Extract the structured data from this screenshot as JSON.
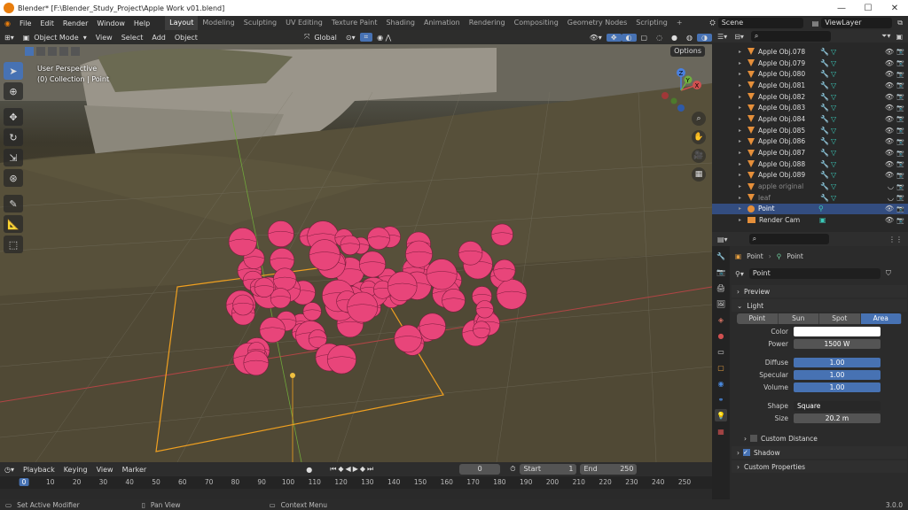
{
  "window": {
    "title": "Blender* [F:\\Blender_Study_Project\\Apple Work v01.blend]",
    "buttons": [
      "—",
      "☐",
      "✕"
    ]
  },
  "menu": [
    "File",
    "Edit",
    "Render",
    "Window",
    "Help"
  ],
  "workspaces": [
    "Layout",
    "Modeling",
    "Sculpting",
    "UV Editing",
    "Texture Paint",
    "Shading",
    "Animation",
    "Rendering",
    "Compositing",
    "Geometry Nodes",
    "Scripting"
  ],
  "active_workspace": "Layout",
  "add_workspace": "+",
  "scene": "Scene",
  "view_layer": "ViewLayer",
  "viewport": {
    "mode": "Object Mode",
    "menus": [
      "View",
      "Select",
      "Add",
      "Object"
    ],
    "transform": "Global",
    "options": "Options",
    "perspective": "User Perspective",
    "collection": "(0) Collection | Point",
    "gizmo": {
      "x": "X",
      "y": "Y",
      "z": "Z"
    }
  },
  "timeline": {
    "menus": [
      "Playback",
      "Keying",
      "View",
      "Marker"
    ],
    "current_frame": "0",
    "start_label": "Start",
    "start": "1",
    "end_label": "End",
    "end": "250",
    "ticks": [
      "0",
      "10",
      "20",
      "30",
      "40",
      "50",
      "60",
      "70",
      "80",
      "90",
      "100",
      "110",
      "120",
      "130",
      "140",
      "150",
      "160",
      "170",
      "180",
      "190",
      "200",
      "210",
      "220",
      "230",
      "240",
      "250"
    ]
  },
  "status": {
    "left": "Set Active Modifier",
    "middle": "Pan View",
    "right": "Context Menu",
    "version": "3.0.0"
  },
  "outliner": {
    "rows": [
      {
        "name": "Apple Obj.078",
        "kind": "mesh"
      },
      {
        "name": "Apple Obj.079",
        "kind": "mesh"
      },
      {
        "name": "Apple Obj.080",
        "kind": "mesh"
      },
      {
        "name": "Apple Obj.081",
        "kind": "mesh"
      },
      {
        "name": "Apple Obj.082",
        "kind": "mesh"
      },
      {
        "name": "Apple Obj.083",
        "kind": "mesh"
      },
      {
        "name": "Apple Obj.084",
        "kind": "mesh"
      },
      {
        "name": "Apple Obj.085",
        "kind": "mesh"
      },
      {
        "name": "Apple Obj.086",
        "kind": "mesh"
      },
      {
        "name": "Apple Obj.087",
        "kind": "mesh"
      },
      {
        "name": "Apple Obj.088",
        "kind": "mesh"
      },
      {
        "name": "Apple Obj.089",
        "kind": "mesh"
      },
      {
        "name": "apple original",
        "kind": "mesh-dim"
      },
      {
        "name": "leaf",
        "kind": "mesh-dim"
      },
      {
        "name": "Point",
        "kind": "light"
      },
      {
        "name": "Render Cam",
        "kind": "camera"
      }
    ]
  },
  "properties": {
    "breadcrumb": [
      "Point",
      "Point"
    ],
    "datablock": "Point",
    "panels": {
      "preview": "Preview",
      "light": "Light",
      "custom_distance": "Custom Distance",
      "shadow": "Shadow",
      "custom_properties": "Custom Properties"
    },
    "light_types": [
      "Point",
      "Sun",
      "Spot",
      "Area"
    ],
    "active_light_type": "Area",
    "fields": {
      "color_label": "Color",
      "power_label": "Power",
      "power": "1500 W",
      "diffuse_label": "Diffuse",
      "diffuse": "1.00",
      "specular_label": "Specular",
      "specular": "1.00",
      "volume_label": "Volume",
      "volume": "1.00",
      "shape_label": "Shape",
      "shape": "Square",
      "size_label": "Size",
      "size": "20.2 m"
    },
    "colors": {
      "light_color": "#ffffff",
      "accent": "#4772b3",
      "apple": "#e8457a",
      "light_outline": "#f0a020"
    }
  }
}
